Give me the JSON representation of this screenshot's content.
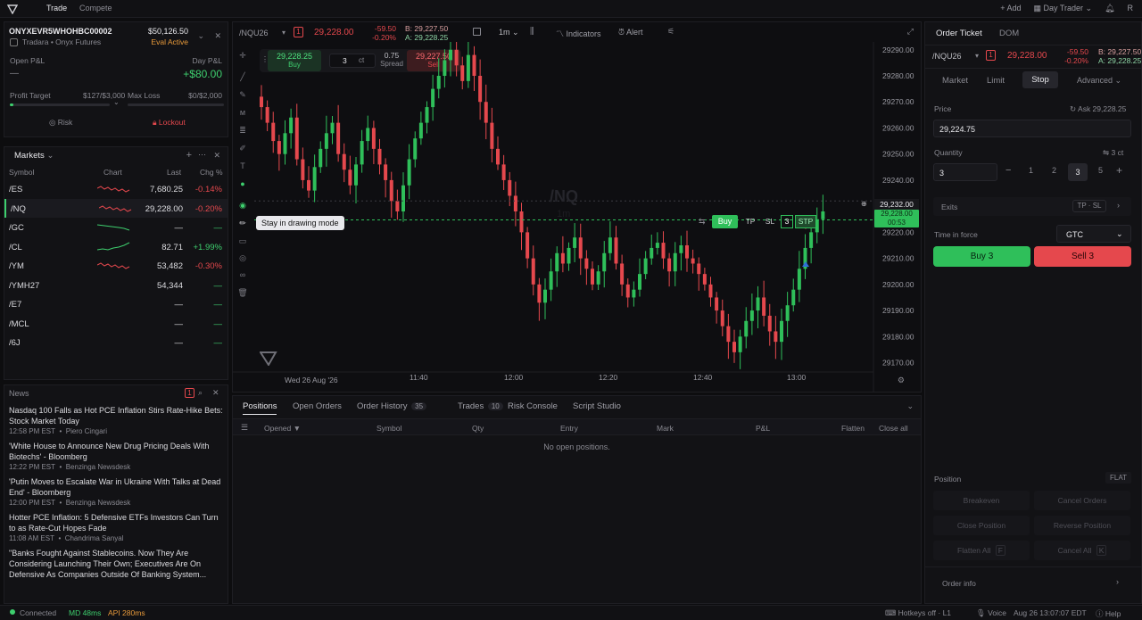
{
  "topbar": {
    "tabs": [
      "Trade",
      "Compete"
    ],
    "add": "+ Add",
    "layout": "Day Trader",
    "user": "R"
  },
  "account": {
    "id": "ONYXEVR5WHOHBC00002",
    "balance": "$50,126.50",
    "org": "Tradara",
    "firm": "• Onyx Futures",
    "status": "Eval Active",
    "open_pnl_label": "Open P&L",
    "open_pnl": "—",
    "day_pnl_label": "Day P&L",
    "day_pnl": "+$80.00",
    "profit_target_label": "Profit Target",
    "profit_target": "$127/$3,000",
    "max_loss_label": "Max Loss",
    "max_loss": "$0/$2,000",
    "risk": "Risk",
    "lockout": "Lockout",
    "profit_progress": 0.04
  },
  "markets": {
    "title": "Markets",
    "headers": [
      "Symbol",
      "Chart",
      "Last",
      "Chg %"
    ],
    "rows": [
      {
        "symbol": "/ES",
        "last": "7,680.25",
        "chg": "-0.14%",
        "dir": "down"
      },
      {
        "symbol": "/NQ",
        "last": "29,228.00",
        "chg": "-0.20%",
        "dir": "down"
      },
      {
        "symbol": "/GC",
        "last": "—",
        "chg": "—",
        "dir": "flat"
      },
      {
        "symbol": "/CL",
        "last": "82.71",
        "chg": "+1.99%",
        "dir": "up"
      },
      {
        "symbol": "/YM",
        "last": "53,482",
        "chg": "-0.30%",
        "dir": "down"
      },
      {
        "symbol": "/YMH27",
        "last": "54,344",
        "chg": "—",
        "dir": "flat"
      },
      {
        "symbol": "/E7",
        "last": "—",
        "chg": "—",
        "dir": "flat"
      },
      {
        "symbol": "/MCL",
        "last": "—",
        "chg": "—",
        "dir": "flat"
      },
      {
        "symbol": "/6J",
        "last": "—",
        "chg": "—",
        "dir": "flat"
      }
    ]
  },
  "news": {
    "title": "News",
    "badge": "1",
    "items": [
      {
        "headline": "Nasdaq 100 Falls as Hot PCE Inflation Stirs Rate-Hike Bets: Stock Market Today",
        "time": "12:58 PM EST",
        "source": "Piero Cingari"
      },
      {
        "headline": "'White House to Announce New Drug Pricing Deals With Biotechs' - Bloomberg",
        "time": "12:22 PM EST",
        "source": "Benzinga Newsdesk"
      },
      {
        "headline": "'Putin Moves to Escalate War in Ukraine With Talks at Dead End' - Bloomberg",
        "time": "12:00 PM EST",
        "source": "Benzinga Newsdesk"
      },
      {
        "headline": "Hotter PCE Inflation: 5 Defensive ETFs Investors Can Turn to as Rate-Cut Hopes Fade",
        "time": "11:08 AM EST",
        "source": "Chandrima Sanyal"
      },
      {
        "headline": "\"Banks Fought Against Stablecoins. Now They Are Considering Launching Their Own; Executives Are On Defensive As Companies Outside Of Banking System...",
        "time": "",
        "source": ""
      }
    ]
  },
  "chart": {
    "symbol": "/NQU26",
    "badge": "1",
    "price": "29,228.00",
    "chg": "-59.50",
    "chg_pct": "-0.20%",
    "bid": "B: 29,227.50",
    "ask": "A: 29,228.25",
    "interval": "1m",
    "indicators": "Indicators",
    "alert": "Alert",
    "buy_price": "29,228.25",
    "buy_label": "Buy",
    "qty": "3",
    "qty_unit": "ct",
    "spread": "0.75",
    "spread_label": "Spread",
    "sell_price": "29,227.50",
    "sell_label": "Sell",
    "watermark": "/NQ",
    "watermark_sub": "1m",
    "tooltip": "Stay in drawing mode",
    "order_line": {
      "buy": "Buy",
      "tp": "TP",
      "sl": "SL",
      "qty": "3",
      "type": "STP"
    },
    "crosshair_price": "29,232.00",
    "last_price": "29,228.00",
    "countdown": "00:53",
    "date_label": "Wed 26 Aug '26",
    "x_ticks": [
      "11:40",
      "12:00",
      "12:20",
      "12:40",
      "13:00"
    ],
    "y_ticks": [
      "29290.00",
      "29280.00",
      "29270.00",
      "29260.00",
      "29250.00",
      "29240.00",
      "29230.00",
      "29220.00",
      "29210.00",
      "29200.00",
      "29190.00",
      "29180.00",
      "29170.00"
    ],
    "colors": {
      "up": "#2fbf5a",
      "down": "#e5484d"
    }
  },
  "chart_data": {
    "type": "candlestick",
    "x_ticks": [
      "11:40",
      "12:00",
      "12:20",
      "12:40",
      "13:00"
    ],
    "ylim": [
      29163,
      29293
    ],
    "last": 29228.0,
    "order_price": 29224.75,
    "closes": [
      29268,
      29262,
      29255,
      29250,
      29258,
      29264,
      29248,
      29240,
      29236,
      29245,
      29252,
      29258,
      29262,
      29250,
      29244,
      29238,
      29246,
      29255,
      29260,
      29252,
      29246,
      29240,
      29232,
      29228,
      29238,
      29248,
      29256,
      29262,
      29268,
      29275,
      29280,
      29286,
      29290,
      29284,
      29278,
      29288,
      29280,
      29270,
      29262,
      29252,
      29246,
      29240,
      29234,
      29228,
      29220,
      29210,
      29200,
      29193,
      29198,
      29205,
      29212,
      29208,
      29214,
      29218,
      29210,
      29206,
      29200,
      29205,
      29212,
      29218,
      29208,
      29200,
      29195,
      29198,
      29204,
      29210,
      29214,
      29216,
      29210,
      29205,
      29212,
      29215,
      29210,
      29208,
      29204,
      29200,
      29195,
      29190,
      29184,
      29178,
      29174,
      29180,
      29186,
      29190,
      29195,
      29188,
      29182,
      29178,
      29186,
      29192,
      29198,
      29206,
      29214,
      29220,
      29225,
      29228
    ]
  },
  "bottom_tabs": {
    "tabs": [
      {
        "label": "Positions"
      },
      {
        "label": "Open Orders"
      },
      {
        "label": "Order History",
        "count": "35"
      },
      {
        "label": "Trades",
        "count": "10"
      },
      {
        "label": "Risk Console"
      },
      {
        "label": "Script Studio"
      }
    ],
    "headers": [
      "Opened ▼",
      "Symbol",
      "Qty",
      "Entry",
      "Mark",
      "P&L",
      "Flatten",
      "Close all"
    ],
    "empty": "No open positions."
  },
  "ticket": {
    "tabs": [
      "Order Ticket",
      "DOM"
    ],
    "symbol": "/NQU26",
    "badge": "1",
    "price": "29,228.00",
    "chg": "-59.50",
    "chg_pct": "-0.20%",
    "bid": "B: 29,227.50",
    "ask": "A: 29,228.25",
    "types": [
      "Market",
      "Limit",
      "Stop"
    ],
    "advanced": "Advanced",
    "price_label": "Price",
    "ask_label": "Ask 29,228.25",
    "price_value": "29,224.75",
    "qty_label": "Quantity",
    "qty_hint": "3 ct",
    "qty_value": "3",
    "qty_presets": [
      "1",
      "2",
      "3",
      "5"
    ],
    "exits_label": "Exits",
    "exits_value": "TP · SL",
    "tif_label": "Time in force",
    "tif_value": "GTC",
    "buy": "Buy 3",
    "sell": "Sell 3",
    "position_label": "Position",
    "position_value": "FLAT",
    "actions": [
      "Breakeven",
      "Cancel Orders",
      "Close Position",
      "Reverse Position",
      "Flatten All",
      "Cancel All"
    ],
    "flatten_key": "F",
    "cancel_key": "K",
    "order_info": "Order info"
  },
  "status": {
    "connected": "Connected",
    "md": "MD 48ms",
    "api": "API 280ms",
    "hotkeys": "Hotkeys off",
    "level": "L1",
    "voice": "Voice",
    "datetime": "Aug 26 13:07:07 EDT",
    "help": "Help"
  }
}
